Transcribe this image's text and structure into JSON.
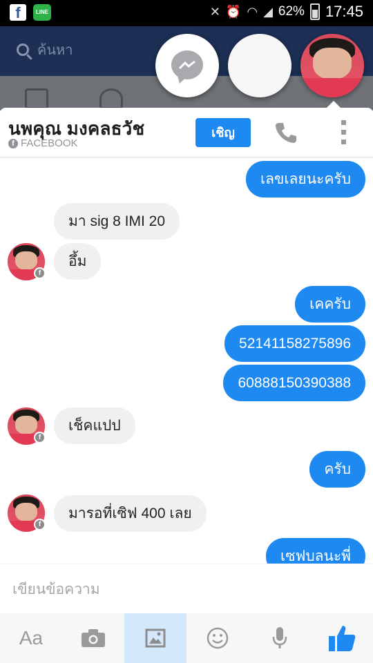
{
  "status_bar": {
    "battery": "62%",
    "time": "17:45",
    "line_badge": "LINE"
  },
  "background_app": {
    "search_placeholder": "ค้นหา"
  },
  "chat": {
    "contact_name": "นพคุณ มงคลธวัช",
    "source_label": "FACEBOOK",
    "invite_label": "เชิญ"
  },
  "messages": [
    {
      "direction": "out",
      "text": "เลขเลยนะครับ"
    },
    {
      "direction": "in",
      "text": "มา sig 8 IMI 20"
    },
    {
      "direction": "in",
      "text": "อึ้ม"
    },
    {
      "direction": "out",
      "text": "เคครับ"
    },
    {
      "direction": "out",
      "text": "52141158275896"
    },
    {
      "direction": "out",
      "text": "60888150390388"
    },
    {
      "direction": "in",
      "text": "เช็คแปป"
    },
    {
      "direction": "out",
      "text": "ครับ"
    },
    {
      "direction": "in",
      "text": "มารอที่เซิฟ 400 เลย"
    },
    {
      "direction": "out",
      "text": "เซฟบลนะพี่"
    }
  ],
  "composer": {
    "placeholder": "เขียนข้อความ"
  },
  "toolbar": {
    "text_label": "Aa",
    "items": [
      "text-format",
      "camera",
      "gallery",
      "emoji",
      "microphone",
      "like"
    ],
    "active": "gallery"
  },
  "colors": {
    "accent": "#1e89f0",
    "incoming_bubble": "#f1f0f0",
    "header_dark": "#1d2f55"
  }
}
